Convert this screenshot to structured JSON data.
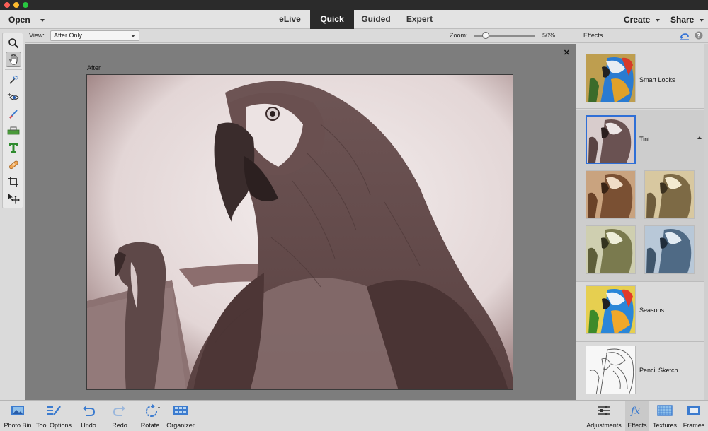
{
  "menubar": {
    "open_label": "Open",
    "modes": [
      "eLive",
      "Quick",
      "Guided",
      "Expert"
    ],
    "active_mode": "Quick",
    "create_label": "Create",
    "share_label": "Share"
  },
  "options": {
    "view_label": "View:",
    "view_value": "After Only",
    "zoom_label": "Zoom:",
    "zoom_value": "50%",
    "zoom_percent": 50
  },
  "canvas": {
    "after_label": "After",
    "close_glyph": "✕"
  },
  "toolbox": {
    "tools": [
      "zoom-tool",
      "hand-tool",
      "quick-selection-tool",
      "red-eye-tool",
      "whiten-teeth-tool",
      "straighten-tool",
      "type-tool",
      "spot-healing-tool",
      "crop-tool",
      "move-tool"
    ],
    "selected": "hand-tool"
  },
  "effects": {
    "title": "Effects",
    "items": [
      {
        "name": "Smart Looks"
      },
      {
        "name": "Tint",
        "expanded": true
      },
      {
        "name": "Seasons"
      },
      {
        "name": "Pencil Sketch"
      }
    ],
    "tint_variants": [
      "warm-brown",
      "gold",
      "olive",
      "cool-blue"
    ]
  },
  "taskbar": {
    "left": [
      "Photo Bin",
      "Tool Options",
      "Undo",
      "Redo",
      "Rotate",
      "Organizer"
    ],
    "right": [
      "Adjustments",
      "Effects",
      "Textures",
      "Frames"
    ],
    "active_right": "Effects"
  },
  "colors": {
    "active_mode_bg": "#2a2a2a",
    "accent_blue": "#2f6fd6",
    "icon_blue": "#3b7bcf"
  }
}
